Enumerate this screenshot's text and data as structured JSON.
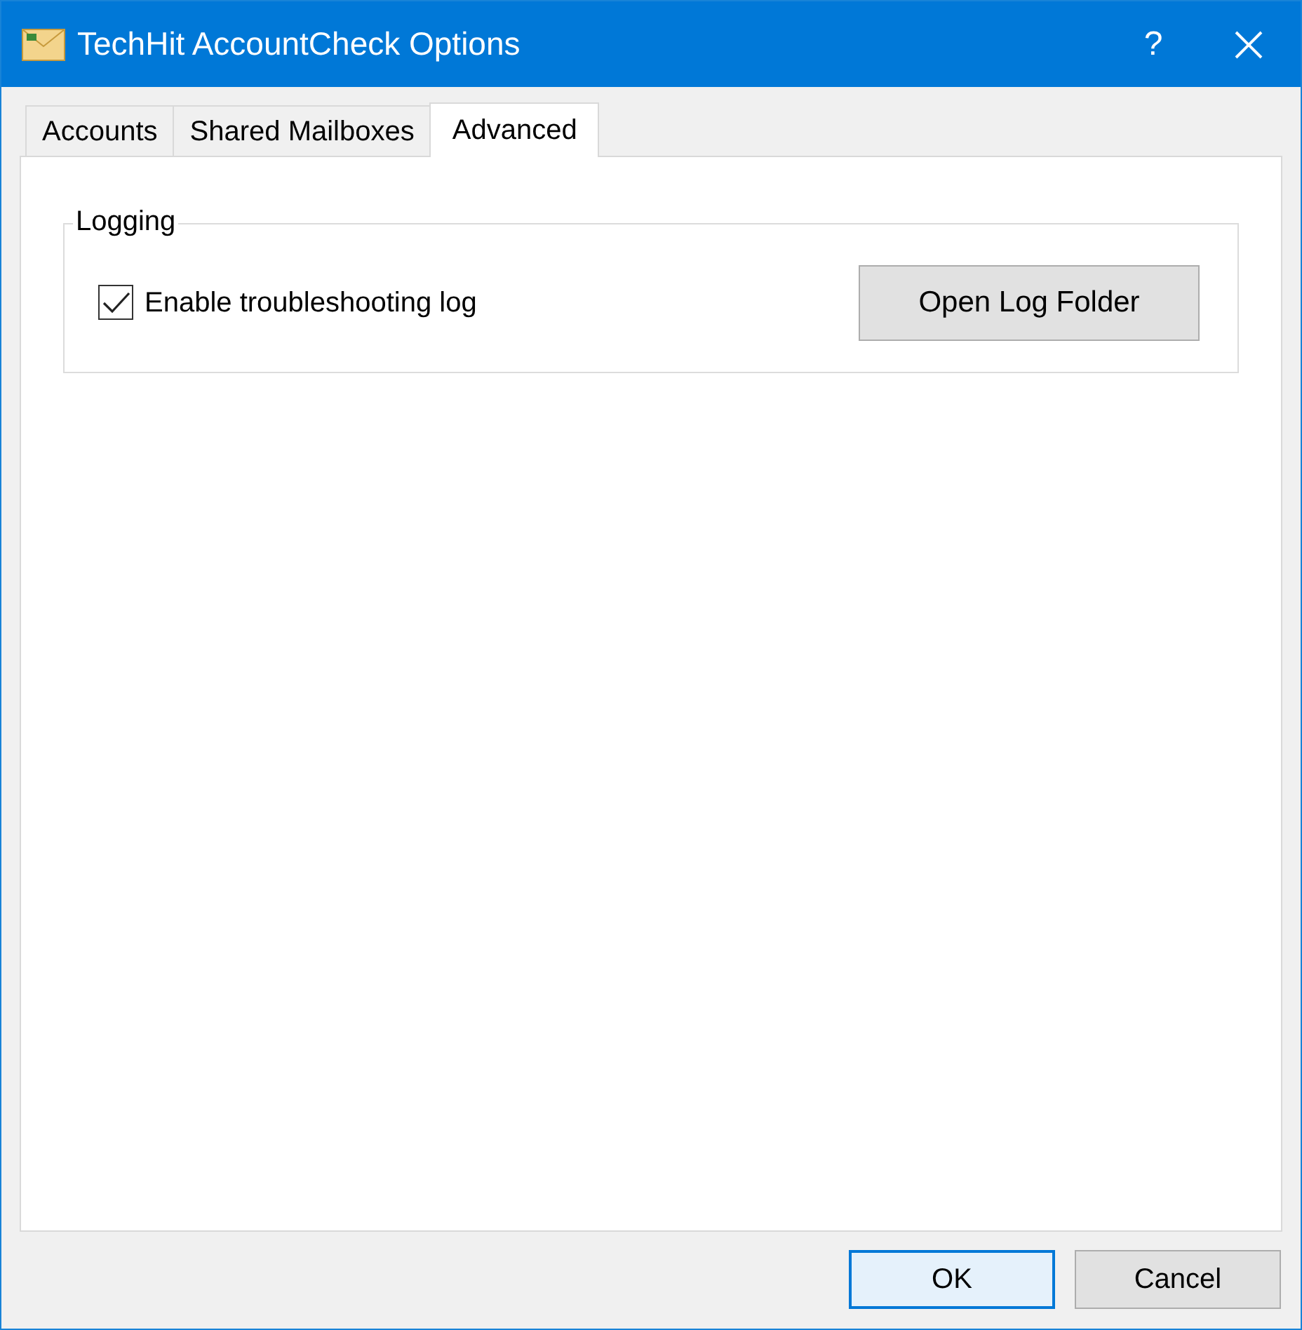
{
  "window": {
    "title": "TechHit AccountCheck Options",
    "help": "?"
  },
  "tabs": [
    {
      "label": "Accounts",
      "selected": false
    },
    {
      "label": "Shared Mailboxes",
      "selected": false
    },
    {
      "label": "Advanced",
      "selected": true
    }
  ],
  "logging": {
    "title": "Logging",
    "checkbox": {
      "label": "Enable troubleshooting log",
      "checked": true
    },
    "button": "Open Log Folder"
  },
  "buttons": [
    {
      "label": "OK",
      "default": true
    },
    {
      "label": "Cancel",
      "default": false
    }
  ]
}
